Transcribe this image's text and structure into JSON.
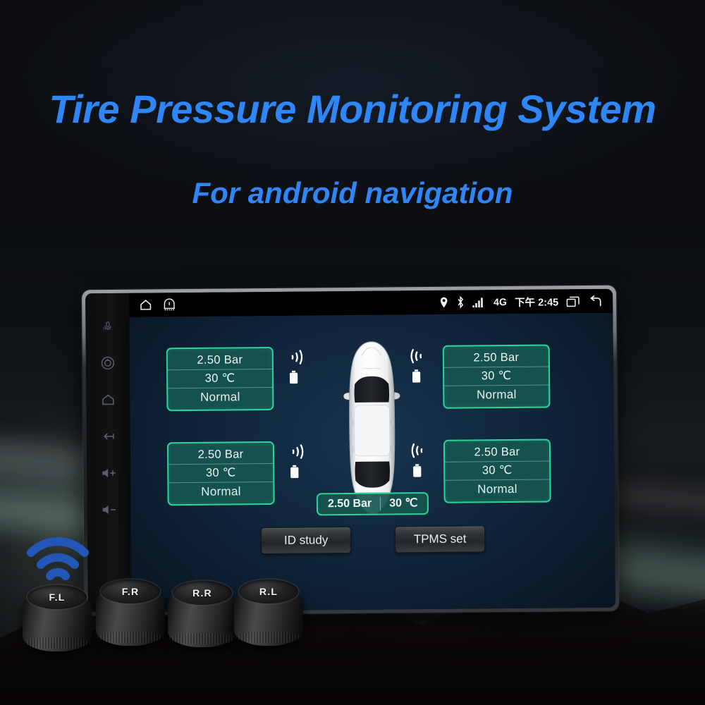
{
  "promo": {
    "headline": "Tire Pressure Monitoring System",
    "subhead": "For android navigation",
    "accent_color": "#2f86f7"
  },
  "head_unit": {
    "side_buttons": [
      {
        "name": "mic-button",
        "label": "MIC"
      },
      {
        "name": "power-button",
        "label": ""
      },
      {
        "name": "home-hw-button",
        "label": ""
      },
      {
        "name": "back-hw-button",
        "label": ""
      },
      {
        "name": "volume-up-button",
        "label": ""
      },
      {
        "name": "volume-down-button",
        "label": ""
      }
    ]
  },
  "status_bar": {
    "home_icon": "home-icon",
    "tpms_warning_icon": "tpms-warning-icon",
    "location_icon": "location-pin-icon",
    "bluetooth_icon": "bluetooth-icon",
    "signal_icon": "cellular-signal-icon",
    "network": "4G",
    "time": "下午 2:45",
    "recents_icon": "recent-apps-icon",
    "back_icon": "back-arrow-icon"
  },
  "app": {
    "accent_border": "#2fd39a",
    "panel_fill": "#16564f",
    "tires": [
      {
        "position": "front-left",
        "pressure": "2.50  Bar",
        "temperature": "30  ℃",
        "status": "Normal"
      },
      {
        "position": "front-right",
        "pressure": "2.50  Bar",
        "temperature": "30  ℃",
        "status": "Normal"
      },
      {
        "position": "rear-left",
        "pressure": "2.50  Bar",
        "temperature": "30  ℃",
        "status": "Normal"
      },
      {
        "position": "rear-right",
        "pressure": "2.50  Bar",
        "temperature": "30  ℃",
        "status": "Normal"
      }
    ],
    "spare": {
      "pressure": "2.50 Bar",
      "temperature": "30  ℃"
    },
    "buttons": {
      "id_study": "ID study",
      "tpms_set": "TPMS set"
    }
  },
  "sensors": {
    "wifi_icon": "wifi-icon",
    "caps": [
      {
        "label": "F.L"
      },
      {
        "label": "F.R"
      },
      {
        "label": "R.R"
      },
      {
        "label": "R.L"
      }
    ]
  }
}
